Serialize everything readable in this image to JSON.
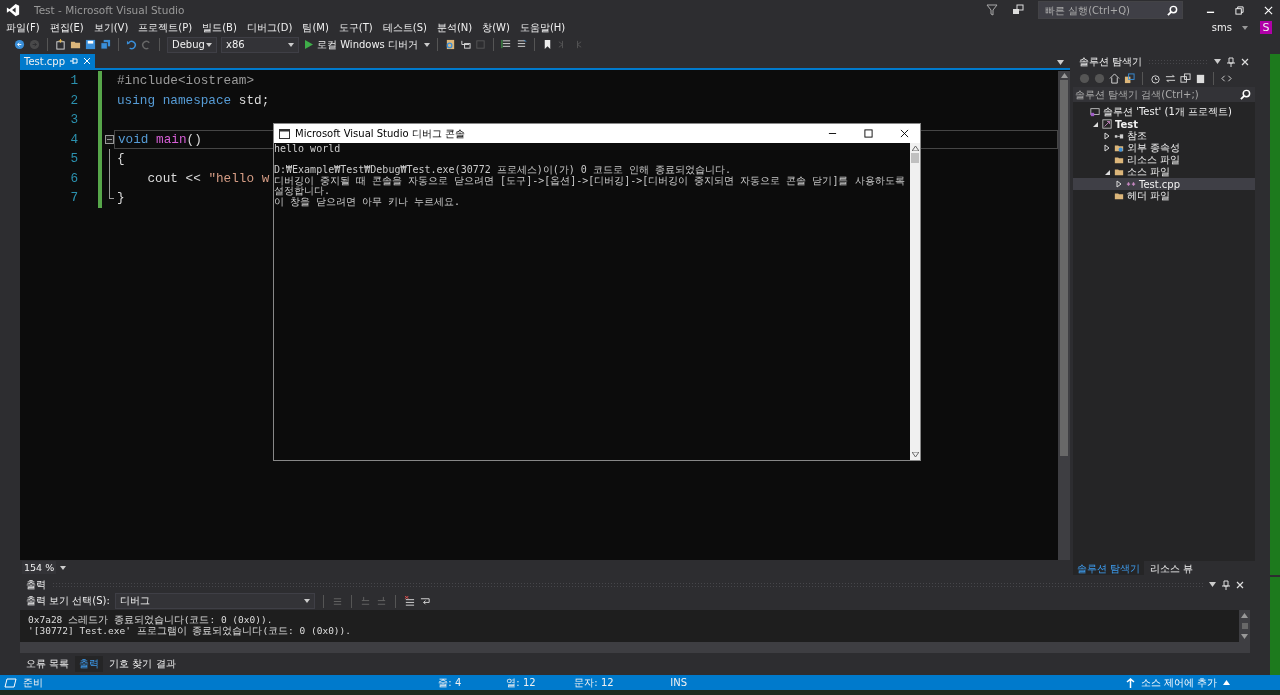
{
  "window": {
    "title": "Test - Microsoft Visual Studio"
  },
  "quick_launch": {
    "placeholder": "빠른 실행(Ctrl+Q)"
  },
  "account": {
    "name": "sms",
    "initial": "S"
  },
  "menu": [
    "파일(F)",
    "편집(E)",
    "보기(V)",
    "프로젝트(P)",
    "빌드(B)",
    "디버그(D)",
    "팀(M)",
    "도구(T)",
    "테스트(S)",
    "분석(N)",
    "창(W)",
    "도움말(H)"
  ],
  "toolbar": {
    "configuration": "Debug",
    "platform": "x86",
    "run_label": "로컬 Windows 디버거"
  },
  "tabs": [
    {
      "label": "Test.cpp",
      "selected": true
    }
  ],
  "editor": {
    "zoom": "154 %",
    "lines": [
      {
        "number": "1",
        "current": false,
        "kind": "plain",
        "tokens": [
          {
            "kind": "preproc",
            "text": "#include<iostream>"
          }
        ]
      },
      {
        "number": "2",
        "current": false,
        "kind": "plain",
        "tokens": [
          {
            "kind": "keyword",
            "text": "using namespace"
          },
          {
            "kind": "plain",
            "text": " std;"
          }
        ]
      },
      {
        "number": "3",
        "current": false,
        "kind": "plain"
      },
      {
        "number": "4",
        "current": true,
        "kind": "fold_start",
        "tokens": [
          {
            "kind": "keyword",
            "text": "void"
          },
          {
            "kind": "function",
            "text": " main"
          },
          {
            "kind": "plain",
            "text": "()"
          }
        ]
      },
      {
        "number": "5",
        "current": false,
        "kind": "fold_inside",
        "tokens": [
          {
            "kind": "plain",
            "text": "{"
          }
        ]
      },
      {
        "number": "6",
        "current": false,
        "kind": "fold_inside",
        "tokens": [
          {
            "kind": "plain",
            "text": "    cout << "
          },
          {
            "kind": "string",
            "text": "\"hello w"
          }
        ]
      },
      {
        "number": "7",
        "current": false,
        "kind": "fold_end",
        "tokens": [
          {
            "kind": "plain",
            "text": "}"
          }
        ]
      }
    ]
  },
  "console": {
    "title": "Microsoft Visual Studio 디버그 콘솔",
    "blocks": [
      {
        "lines": [
          "hello world"
        ]
      },
      {
        "lines": [
          "D:₩Example₩Test₩Debug₩Test.exe(30772 프로세스)이(가) 0 코드로 인해 종료되었습니다.",
          "디버깅이 중지될 때 콘솔을 자동으로 닫으려면 [도구]->[옵션]->[디버깅]->[디버깅이 중지되면 자동으로 콘솔 닫기]를 사용하도록 설정합니다.",
          "이 창을 닫으려면 아무 키나 누르세요."
        ]
      }
    ]
  },
  "solution_explorer": {
    "title": "솔루션 탐색기",
    "search_placeholder": "솔루션 탐색기 검색(Ctrl+;)",
    "tree": [
      {
        "label": "솔루션 'Test' (1개 프로젝트)",
        "kind": "solution",
        "selected": false,
        "children": [
          {
            "label": "Test",
            "kind": "project",
            "expanded": true,
            "selected": false,
            "children": [
              {
                "label": "참조",
                "kind": "references",
                "expanded": false,
                "selected": false
              },
              {
                "label": "외부 종속성",
                "kind": "external",
                "expanded": false,
                "selected": false
              },
              {
                "label": "리소스 파일",
                "kind": "folder",
                "selected": false
              },
              {
                "label": "소스 파일",
                "kind": "folder",
                "expanded": true,
                "selected": false,
                "children": [
                  {
                    "label": "Test.cpp",
                    "kind": "cpp",
                    "expanded": false,
                    "selected": true
                  }
                ]
              },
              {
                "label": "헤더 파일",
                "kind": "folder",
                "selected": false
              }
            ]
          }
        ]
      }
    ],
    "tabs": [
      {
        "label": "솔루션 탐색기",
        "selected": true
      },
      {
        "label": "리소스 뷰",
        "selected": false
      }
    ]
  },
  "output": {
    "title": "출력",
    "source_label": "출력 보기 선택(S):",
    "source": "디버그",
    "lines": [
      "0x7a28 스레드가 종료되었습니다(코드: 0 (0x0)).",
      "'[30772] Test.exe' 프로그램이 종료되었습니다(코드: 0 (0x0))."
    ],
    "tabs": [
      {
        "label": "오류 목록",
        "selected": false
      },
      {
        "label": "출력",
        "selected": true
      },
      {
        "label": "기호 찾기 결과",
        "selected": false
      }
    ]
  },
  "status_bar": {
    "message": "준비",
    "line": "줄: 4",
    "column": "열: 12",
    "char": "문자: 12",
    "mode": "INS",
    "source_control": "소스 제어에 추가"
  }
}
